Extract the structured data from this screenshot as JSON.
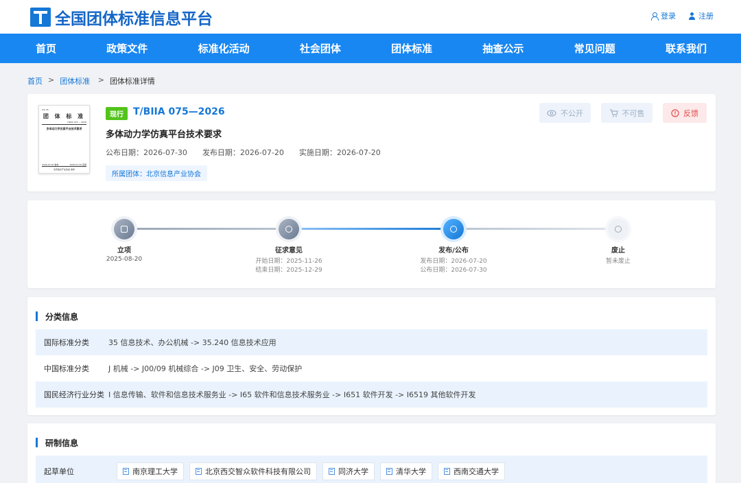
{
  "header": {
    "site_title": "全国团体标准信息平台",
    "login": "登录",
    "register": "注册"
  },
  "nav": [
    "首页",
    "政策文件",
    "标准化活动",
    "社会团体",
    "团体标准",
    "抽查公示",
    "常见问题",
    "联系我们"
  ],
  "breadcrumb": {
    "home": "首页",
    "section": "团体标准",
    "current": "团体标准详情"
  },
  "standard": {
    "status": "现行",
    "code": "T/BIIA 075—2026",
    "title": "多体动力学仿真平台技术要求",
    "publish_date": "公布日期：2026-07-30",
    "release_date": "发布日期：2026-07-20",
    "effective_date": "实施日期：2026-07-20",
    "org": "所属团体：北京信息产业协会",
    "thumbnail": {
      "ics": "ICS 35",
      "heading": "团 体 标 准",
      "code": "T/BIIA 075 — 2026",
      "title": "多体动力学仿真平台技术要求",
      "release": "2026-07-20 发布",
      "effective": "2026-07-20 实施",
      "issuer": "北京信息产业协会 发布"
    },
    "actions": {
      "private": "不公开",
      "not_for_sale": "不可售",
      "feedback": "反馈"
    }
  },
  "timeline": [
    {
      "label": "立项",
      "lines": [
        "2025-08-20"
      ]
    },
    {
      "label": "征求意见",
      "lines": [
        "开始日期：2025-11-26",
        "结束日期：2025-12-29"
      ]
    },
    {
      "label": "发布/公布",
      "lines": [
        "发布日期：2026-07-20",
        "公布日期：2026-07-30"
      ]
    },
    {
      "label": "废止",
      "lines": [
        "暂未废止"
      ]
    }
  ],
  "classification": {
    "title": "分类信息",
    "rows": [
      {
        "key": "国际标准分类",
        "value": "35 信息技术、办公机械 -> 35.240 信息技术应用"
      },
      {
        "key": "中国标准分类",
        "value": "J 机械 -> J00/09 机械综合 -> J09 卫生、安全、劳动保护"
      },
      {
        "key": "国民经济行业分类",
        "value": "I 信息传输、软件和信息技术服务业 -> I65 软件和信息技术服务业 -> I651 软件开发 -> I6519 其他软件开发"
      }
    ]
  },
  "development": {
    "title": "研制信息",
    "drafter_label": "起草单位",
    "drafters": [
      "南京理工大学",
      "北京西交智众软件科技有限公司",
      "同济大学",
      "清华大学",
      "西南交通大学"
    ]
  },
  "colors": {
    "primary": "#1677d6",
    "nav": "#1887f2",
    "current_badge": "#52c41a",
    "feedback": "#e24b4b"
  }
}
